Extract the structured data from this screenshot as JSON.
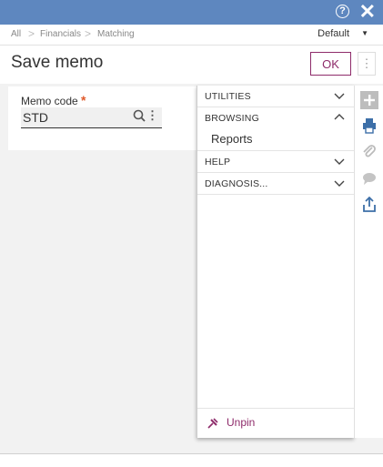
{
  "titlebar": {
    "help_icon": "question-circle-icon",
    "close_icon": "close-icon",
    "help_glyph": "?",
    "close_glyph": "✕"
  },
  "breadcrumb": {
    "items": [
      "All",
      "Financials",
      "Matching"
    ],
    "separator": ">"
  },
  "variant": {
    "label": "Default",
    "caret": "▼"
  },
  "header": {
    "title": "Save memo",
    "ok_label": "OK",
    "more_glyph": "⋮"
  },
  "form": {
    "memo_code": {
      "label": "Memo code",
      "required_mark": "*",
      "value": "STD",
      "kebab": "⋮"
    }
  },
  "panel": {
    "sections": [
      {
        "label": "UTILITIES",
        "expanded": false
      },
      {
        "label": "BROWSING",
        "expanded": true,
        "items": [
          "Reports"
        ]
      },
      {
        "label": "HELP",
        "expanded": false
      },
      {
        "label": "DIAGNOSIS...",
        "expanded": false
      }
    ],
    "unpin_label": "Unpin"
  },
  "colors": {
    "titlebar": "#5e87bf",
    "accent": "#8e2b6a",
    "toolbar_icon": "#3d6fa8",
    "required": "#e05a2b"
  },
  "toolbar": {
    "icons": [
      "plus-icon",
      "print-icon",
      "paperclip-icon",
      "comment-icon",
      "share-icon"
    ]
  }
}
